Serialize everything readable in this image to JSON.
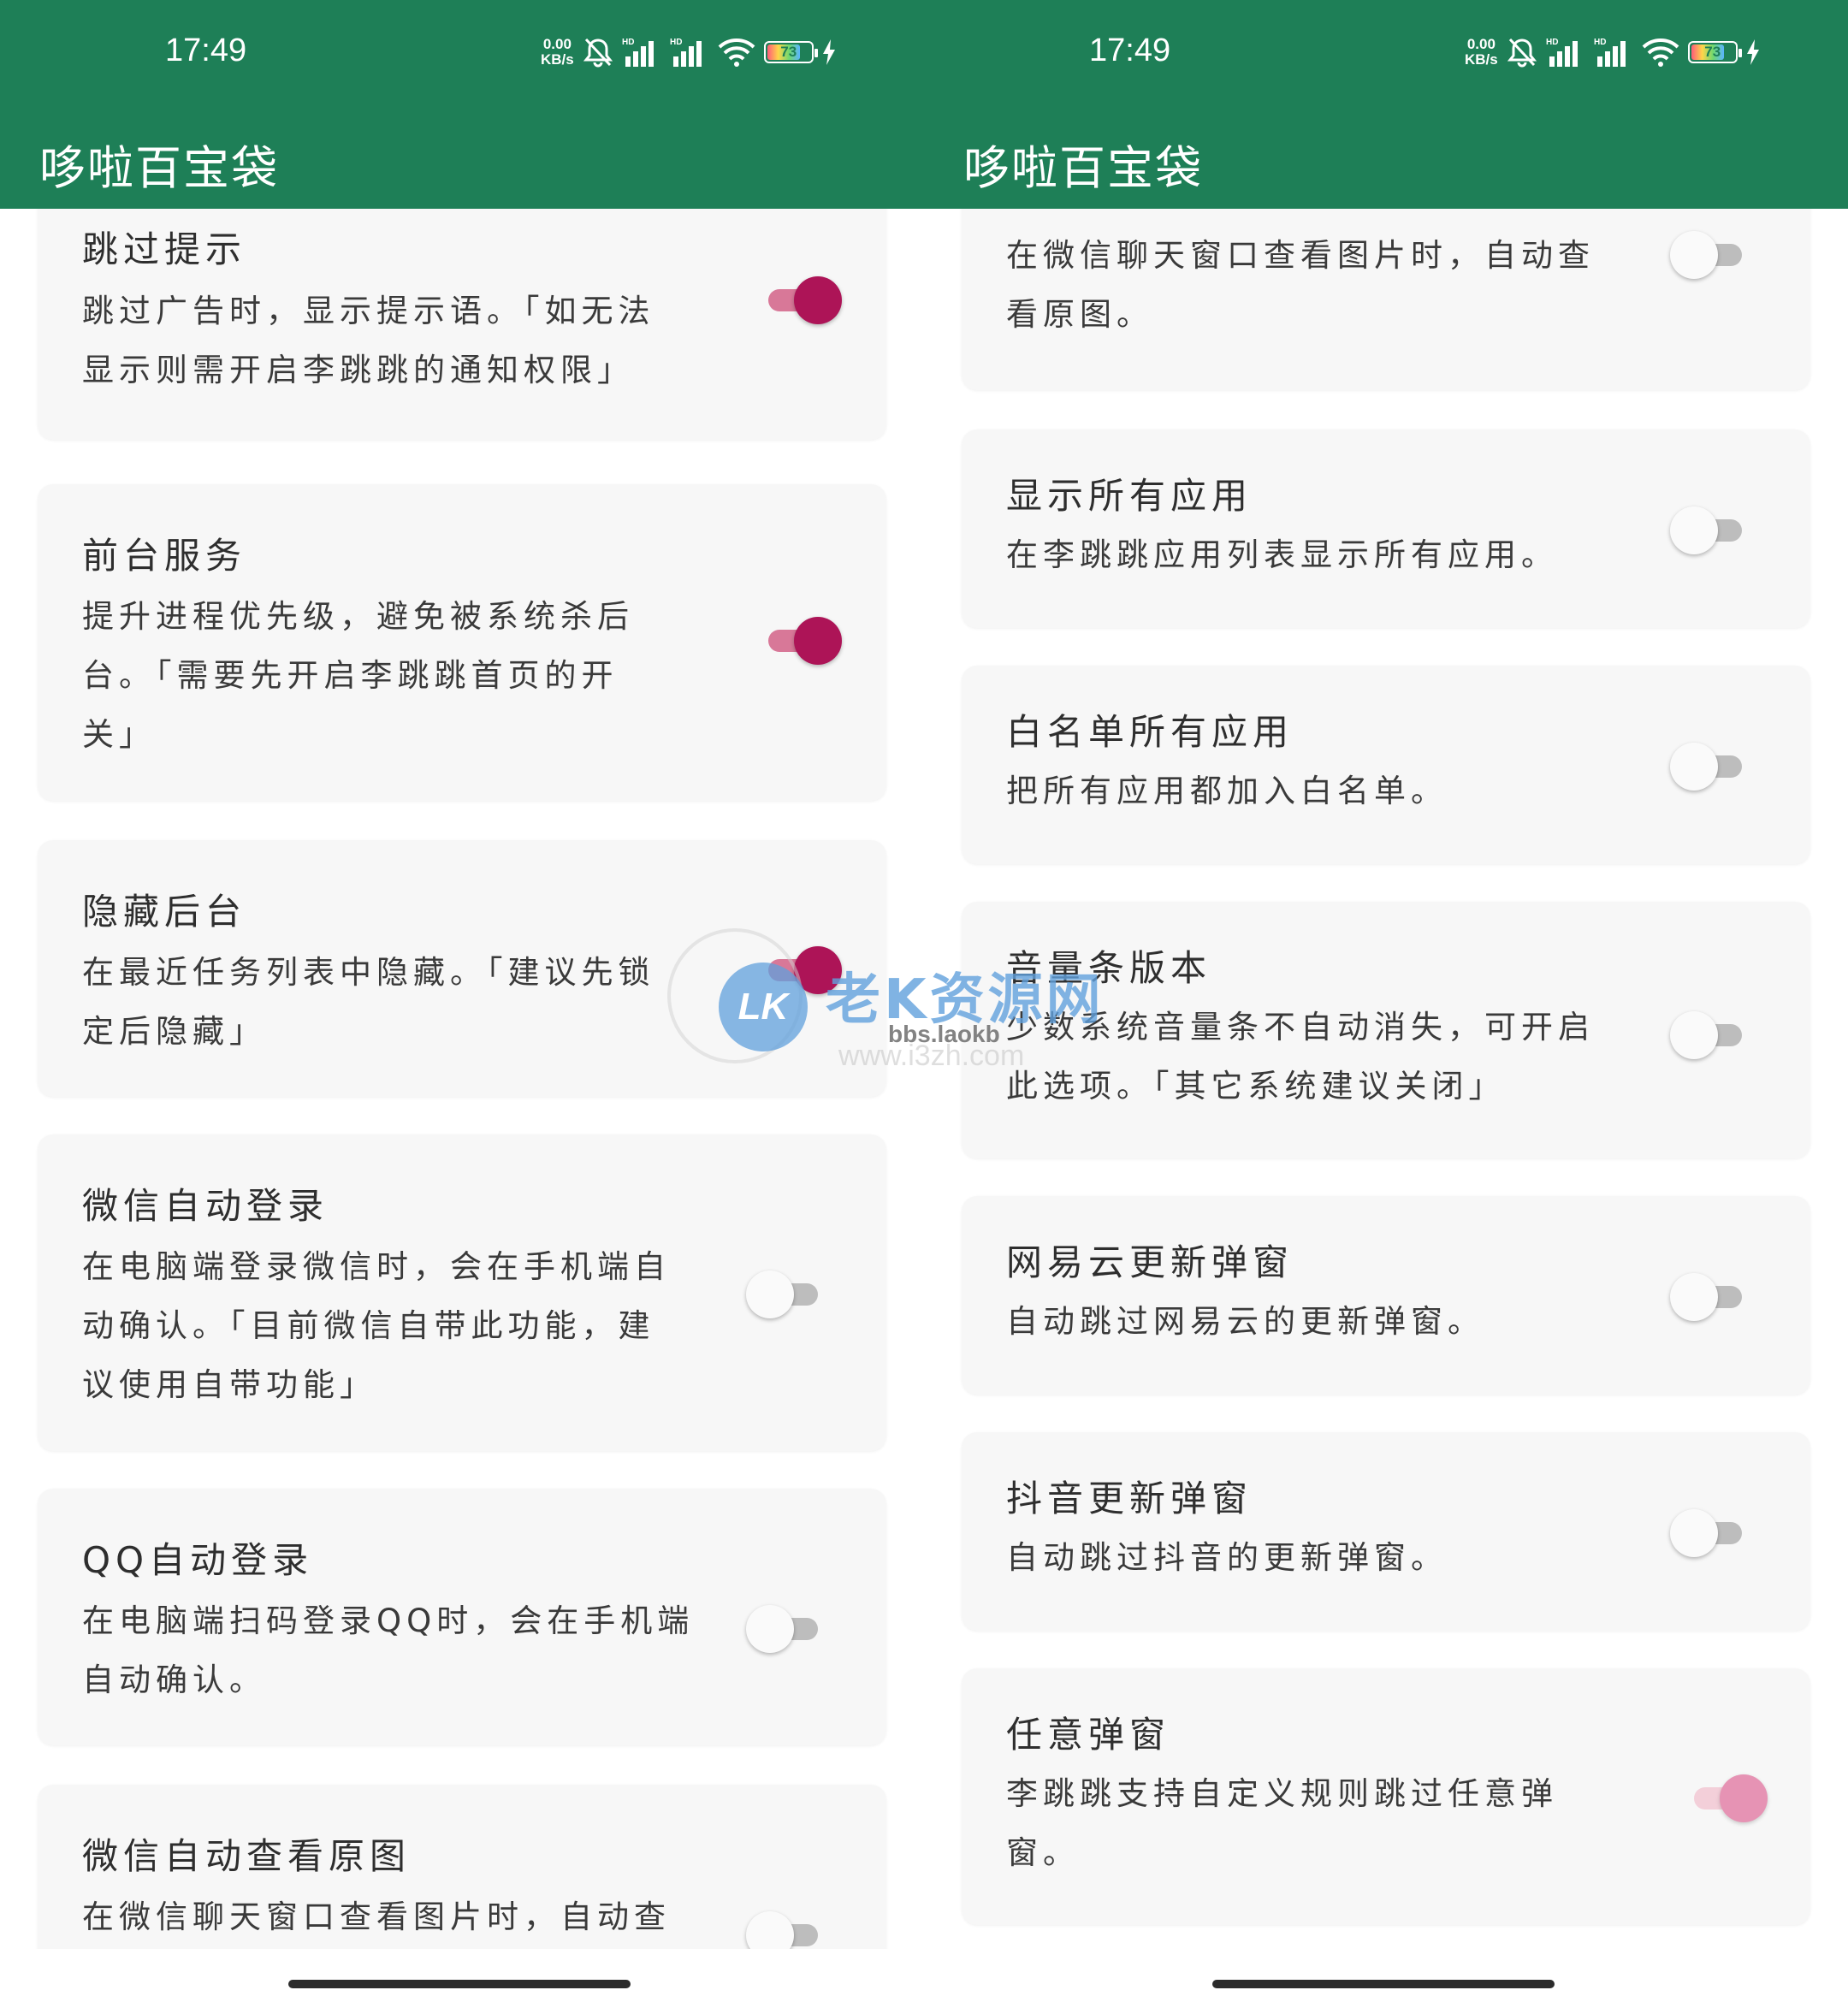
{
  "status_bar": {
    "time": "17:49",
    "net_speed_value": "0.00",
    "net_speed_unit": "KB/s",
    "network_labels": [
      "HD",
      "HD"
    ],
    "battery": "73"
  },
  "app": {
    "title": "哆啦百宝袋"
  },
  "colors": {
    "app_bar": "#1e7f57",
    "switch_on": "#ad1457",
    "card": "#f7f7f7"
  },
  "left_settings": [
    {
      "title": "跳过提示",
      "desc_lines": [
        "跳过广告时，显示提示语。「如无法",
        "显示则需开启李跳跳的通知权限」"
      ],
      "enabled": true
    },
    {
      "title": "前台服务",
      "desc_lines": [
        "提升进程优先级，避免被系统杀后",
        "台。「需要先开启李跳跳首页的开",
        "关」"
      ],
      "enabled": true
    },
    {
      "title": "隐藏后台",
      "desc_lines": [
        "在最近任务列表中隐藏。「建议先锁",
        "定后隐藏」"
      ],
      "enabled": true
    },
    {
      "title": "微信自动登录",
      "desc_lines": [
        "在电脑端登录微信时，会在手机端自",
        "动确认。「目前微信自带此功能，建",
        "议使用自带功能」"
      ],
      "enabled": false
    },
    {
      "title": "QQ自动登录",
      "desc_lines": [
        "在电脑端扫码登录QQ时，会在手机端",
        "自动确认。"
      ],
      "enabled": false
    },
    {
      "title": "微信自动查看原图",
      "desc_lines": [
        "在微信聊天窗口查看图片时，自动查"
      ],
      "enabled": false
    }
  ],
  "right_settings": [
    {
      "title": "",
      "desc_lines": [
        "在微信聊天窗口查看图片时，自动查",
        "看原图。"
      ],
      "enabled": false
    },
    {
      "title": "显示所有应用",
      "desc_lines": [
        "在李跳跳应用列表显示所有应用。"
      ],
      "enabled": false
    },
    {
      "title": "白名单所有应用",
      "desc_lines": [
        "把所有应用都加入白名单。"
      ],
      "enabled": false
    },
    {
      "title": "音量条版本",
      "desc_lines": [
        "少数系统音量条不自动消失，可开启",
        "此选项。「其它系统建议关闭」"
      ],
      "enabled": false
    },
    {
      "title": "网易云更新弹窗",
      "desc_lines": [
        "自动跳过网易云的更新弹窗。"
      ],
      "enabled": false
    },
    {
      "title": "抖音更新弹窗",
      "desc_lines": [
        "自动跳过抖音的更新弹窗。"
      ],
      "enabled": false
    },
    {
      "title": "任意弹窗",
      "desc_lines": [
        "李跳跳支持自定义规则跳过任意弹",
        "窗。"
      ],
      "enabled": true
    }
  ],
  "watermark": {
    "logo": "LK",
    "title": "老K资源网",
    "url": "bbs.laokb",
    "url2": "www.i3zh.com"
  }
}
